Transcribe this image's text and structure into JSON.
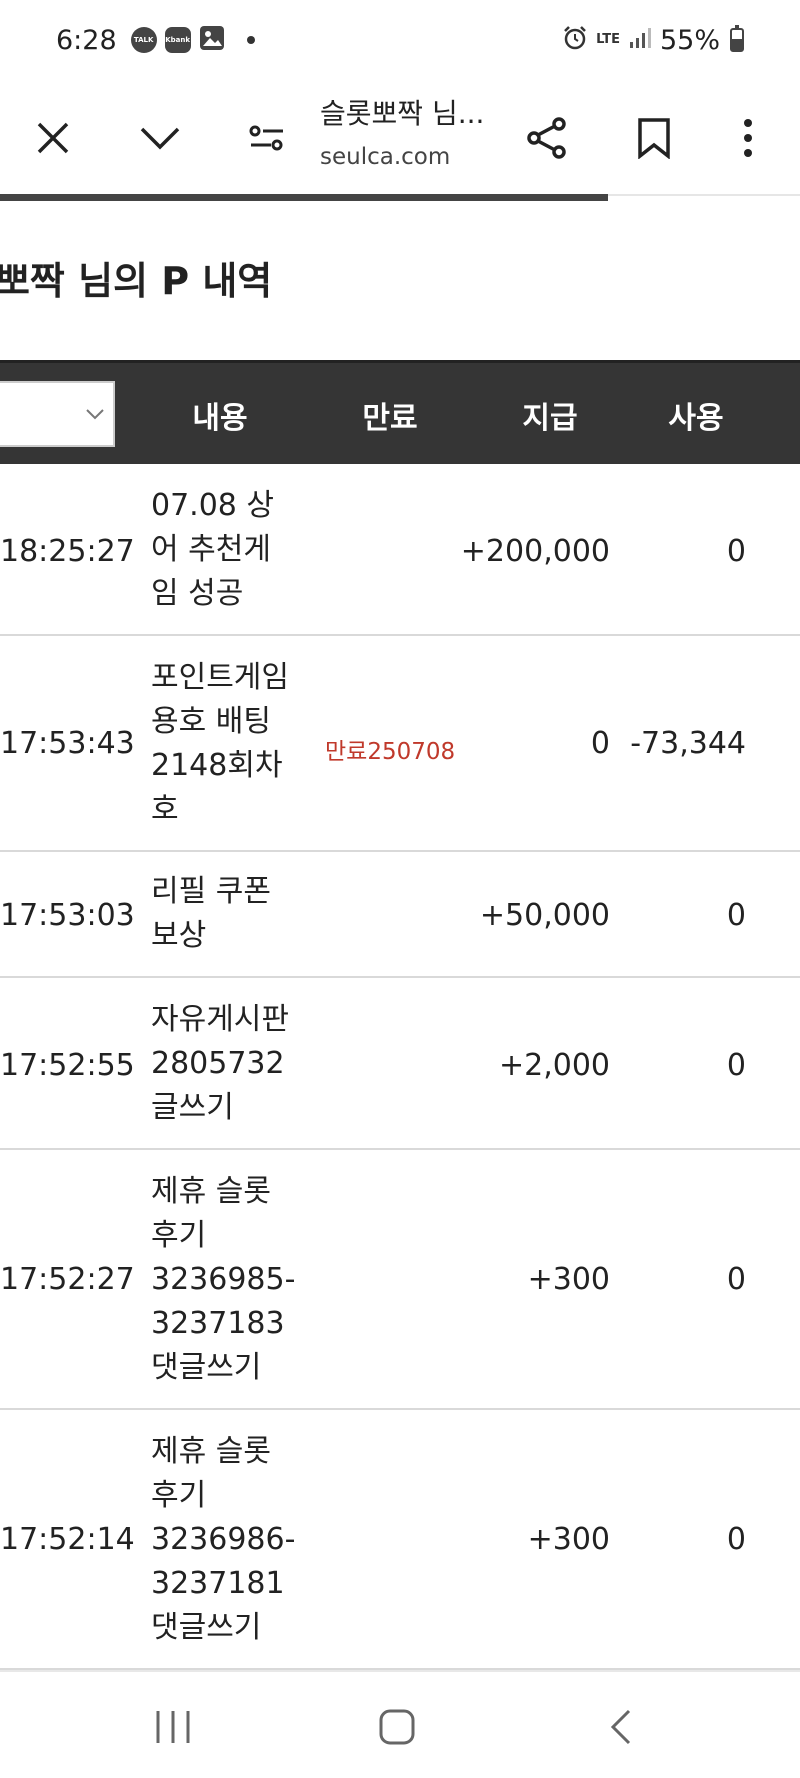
{
  "status_bar": {
    "time": "6:28",
    "notif_talk": "TALK",
    "notif_kbank": "Kbank",
    "network": "LTE",
    "battery": "55%"
  },
  "toolbar": {
    "title": "슬롯뽀짝 님...",
    "url": "seulca.com"
  },
  "page": {
    "title": "롯뽀짝 님의 P 내역"
  },
  "table": {
    "headers": {
      "content": "내용",
      "expire": "만료",
      "pay": "지급",
      "use": "사용"
    },
    "rows": [
      {
        "time": "18:25:27",
        "content_lines": [
          "07.08 상",
          "어 추천게",
          "임 성공"
        ],
        "expire": "",
        "pay": "+200,000",
        "use": "0"
      },
      {
        "time": "17:53:43",
        "content_lines": [
          "포인트게임",
          "용호 배팅",
          "2148회차",
          "호"
        ],
        "expire": "만료250708",
        "pay": "0",
        "use": "-73,344"
      },
      {
        "time": "17:53:03",
        "content_lines": [
          "리필 쿠폰",
          "보상"
        ],
        "expire": "",
        "pay": "+50,000",
        "use": "0"
      },
      {
        "time": "17:52:55",
        "content_lines": [
          "자유게시판",
          "2805732",
          "글쓰기"
        ],
        "expire": "",
        "pay": "+2,000",
        "use": "0"
      },
      {
        "time": "17:52:27",
        "content_lines": [
          "제휴 슬롯",
          "후기",
          "3236985-",
          "3237183",
          "댓글쓰기"
        ],
        "expire": "",
        "pay": "+300",
        "use": "0"
      },
      {
        "time": "17:52:14",
        "content_lines": [
          "제휴 슬롯",
          "후기",
          "3236986-",
          "3237181",
          "댓글쓰기"
        ],
        "expire": "",
        "pay": "+300",
        "use": "0"
      }
    ]
  }
}
